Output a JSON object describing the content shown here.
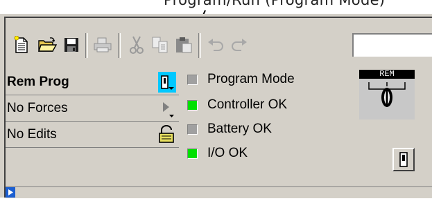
{
  "annotation": {
    "text": "Program/Run (Program Mode)"
  },
  "toolbar": {
    "buttons": [
      {
        "icon": "new-document-icon"
      },
      {
        "icon": "open-folder-icon"
      },
      {
        "icon": "save-floppy-icon"
      },
      {
        "icon": "print-icon"
      },
      {
        "icon": "cut-scissors-icon"
      },
      {
        "icon": "copy-icon"
      },
      {
        "icon": "paste-icon"
      },
      {
        "icon": "undo-icon"
      },
      {
        "icon": "redo-icon"
      }
    ],
    "input_value": ""
  },
  "status": {
    "mode": {
      "label": "Rem Prog",
      "icon": "mode-dropdown-icon"
    },
    "forces": {
      "label": "No Forces",
      "icon": "forces-arrow-icon"
    },
    "edits": {
      "label": "No Edits",
      "icon": "padlock-icon"
    }
  },
  "indicators": [
    {
      "label": "Program Mode",
      "state": "off",
      "color": "#a0a0a0"
    },
    {
      "label": "Controller OK",
      "state": "on",
      "color": "#00e000"
    },
    {
      "label": "Battery OK",
      "state": "off",
      "color": "#a0a0a0"
    },
    {
      "label": "I/O OK",
      "state": "on",
      "color": "#00e000"
    }
  ],
  "keyswitch": {
    "label": "REM"
  },
  "colors": {
    "accent_cyan": "#00c8ff",
    "led_on": "#00e000",
    "led_off": "#a0a0a0",
    "panel": "#d4d0c8"
  }
}
